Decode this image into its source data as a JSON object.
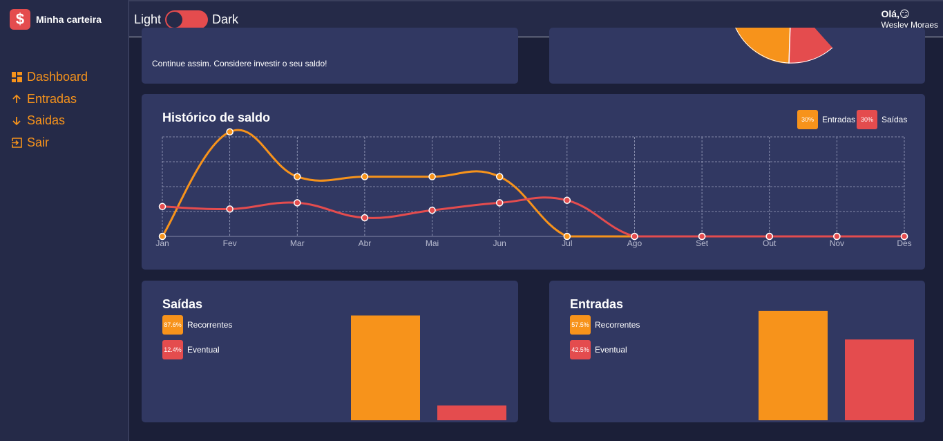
{
  "colors": {
    "orange": "#f7931b",
    "red": "#e44c4e",
    "card": "#313862",
    "bg": "#1b1f38"
  },
  "brand": {
    "logo": "$",
    "name": "Minha carteira"
  },
  "menu": [
    {
      "label": "Dashboard",
      "icon": "dashboard-icon"
    },
    {
      "label": "Entradas",
      "icon": "arrow-up-icon"
    },
    {
      "label": "Saidas",
      "icon": "arrow-down-icon"
    },
    {
      "label": "Sair",
      "icon": "exit-icon"
    }
  ],
  "header": {
    "light_label": "Light",
    "dark_label": "Dark",
    "greeting": "Olá,😏",
    "user": "Wesley Moraes"
  },
  "message": {
    "text": "Continue assim. Considere investir o seu saldo!"
  },
  "pie_partial": {
    "entradas_pct": 30,
    "saidas_pct": 70
  },
  "history": {
    "title": "Histórico de saldo",
    "legend": [
      {
        "pct": "30%",
        "label": "Entradas"
      },
      {
        "pct": "30%",
        "label": "Saídas"
      }
    ],
    "chart_data": {
      "type": "line",
      "categories": [
        "Jan",
        "Fev",
        "Mar",
        "Abr",
        "Mai",
        "Jun",
        "Jul",
        "Ago",
        "Set",
        "Out",
        "Nov",
        "Des"
      ],
      "series": [
        {
          "name": "Entradas",
          "values": [
            0,
            4200,
            2400,
            2400,
            2400,
            2400,
            0,
            0,
            0,
            0,
            0,
            0
          ]
        },
        {
          "name": "Saídas",
          "values": [
            1200,
            1100,
            1350,
            750,
            1050,
            1350,
            1450,
            0,
            0,
            0,
            0,
            0
          ]
        }
      ],
      "ylim": [
        0,
        4000
      ],
      "grid": true
    }
  },
  "saidas": {
    "title": "Saídas",
    "legend": [
      {
        "pct": "87.6%",
        "label": "Recorrentes"
      },
      {
        "pct": "12.4%",
        "label": "Eventual"
      }
    ],
    "chart_data": {
      "type": "bar",
      "categories": [
        "Recorrentes",
        "Eventual"
      ],
      "values": [
        87.6,
        12.4
      ],
      "ylim": [
        0,
        100
      ]
    }
  },
  "entradas": {
    "title": "Entradas",
    "legend": [
      {
        "pct": "57.5%",
        "label": "Recorrentes"
      },
      {
        "pct": "42.5%",
        "label": "Eventual"
      }
    ],
    "chart_data": {
      "type": "bar",
      "categories": [
        "Recorrentes",
        "Eventual"
      ],
      "values": [
        57.5,
        42.5
      ],
      "ylim": [
        0,
        60
      ]
    }
  }
}
